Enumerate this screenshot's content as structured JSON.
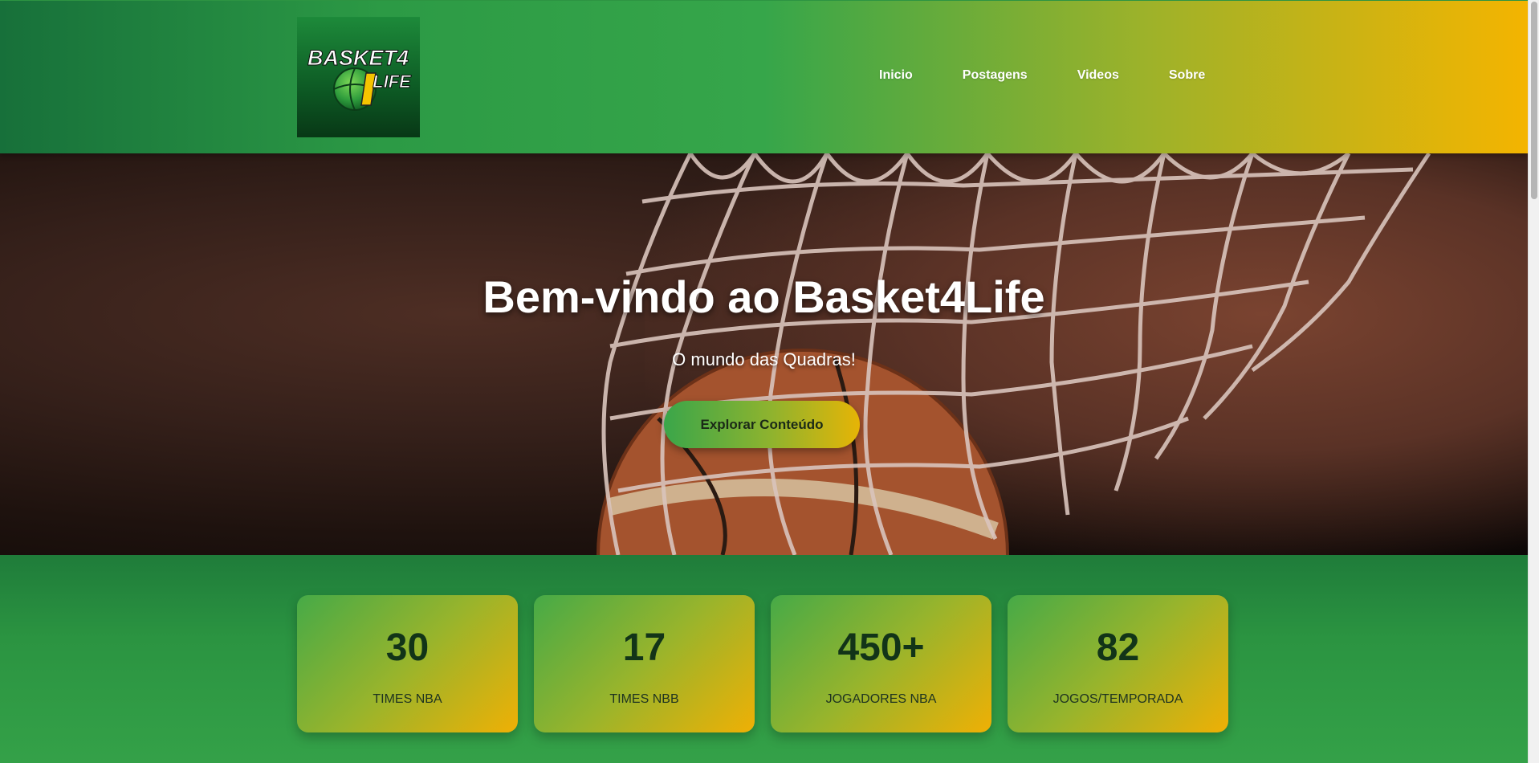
{
  "header": {
    "logo_text_line1": "BASKET4",
    "logo_text_line2": "LIFE",
    "nav": [
      {
        "label": "Inicio"
      },
      {
        "label": "Postagens"
      },
      {
        "label": "Videos"
      },
      {
        "label": "Sobre"
      }
    ]
  },
  "hero": {
    "title": "Bem-vindo ao Basket4Life",
    "subtitle": "O mundo das Quadras!",
    "button_label": "Explorar Conteúdo"
  },
  "stats": [
    {
      "number": "30",
      "label": "TIMES NBA"
    },
    {
      "number": "17",
      "label": "TIMES NBB"
    },
    {
      "number": "450+",
      "label": "JOGADORES NBA"
    },
    {
      "number": "82",
      "label": "JOGOS/TEMPORADA"
    }
  ],
  "colors": {
    "header_gradient_start": "#17703a",
    "header_gradient_end": "#f4b400",
    "stat_text": "#123418"
  }
}
